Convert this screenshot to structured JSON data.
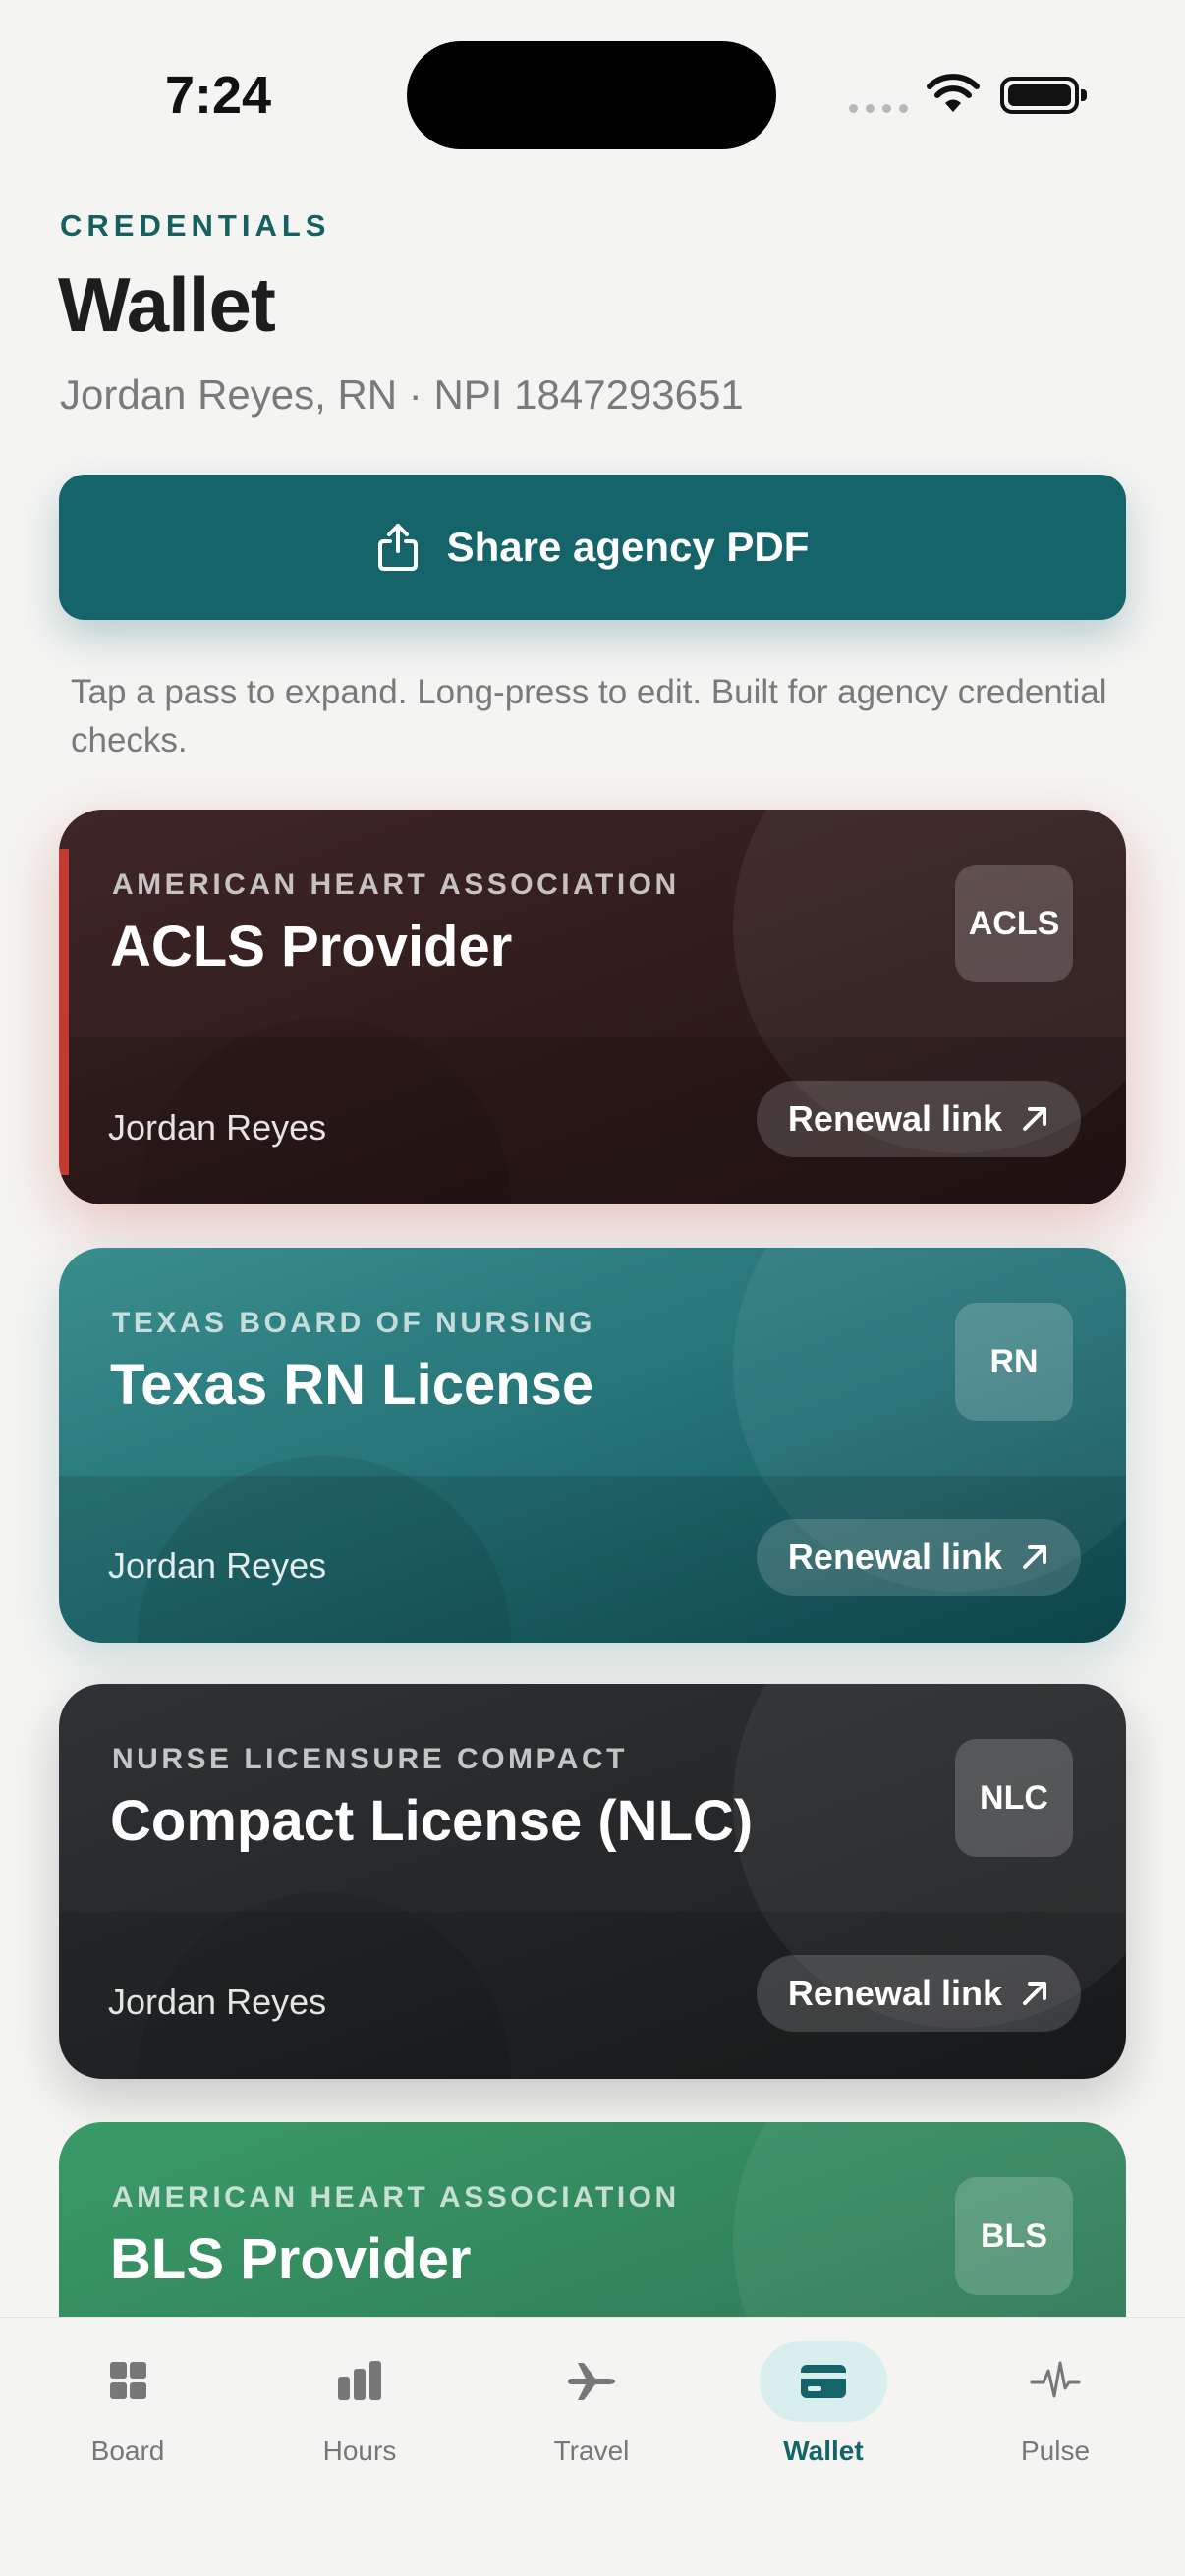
{
  "status_bar": {
    "time": "7:24"
  },
  "header": {
    "eyebrow": "CREDENTIALS",
    "title": "Wallet",
    "subtitle": "Jordan Reyes, RN · NPI 1847293651"
  },
  "share_button": {
    "label": "Share agency PDF"
  },
  "hint": "Tap a pass to expand. Long-press to edit. Built for agency credential checks.",
  "cards": [
    {
      "issuer": "AMERICAN HEART ASSOCIATION",
      "name": "ACLS Provider",
      "badge": "ACLS",
      "holder": "Jordan Reyes",
      "action": "Renewal link",
      "color": "#2d1a1a",
      "alert_color": "#c23a32"
    },
    {
      "issuer": "TEXAS BOARD OF NURSING",
      "name": "Texas RN License",
      "badge": "RN",
      "holder": "Jordan Reyes",
      "action": "Renewal link",
      "color": "#216f74"
    },
    {
      "issuer": "NURSE LICENSURE COMPACT",
      "name": "Compact License (NLC)",
      "badge": "NLC",
      "holder": "Jordan Reyes",
      "action": "Renewal link",
      "color": "#232527"
    },
    {
      "issuer": "AMERICAN HEART ASSOCIATION",
      "name": "BLS Provider",
      "badge": "BLS",
      "color": "#2f7e58"
    }
  ],
  "tabs": [
    {
      "label": "Board",
      "icon": "grid-icon"
    },
    {
      "label": "Hours",
      "icon": "bar-chart-icon"
    },
    {
      "label": "Travel",
      "icon": "airplane-icon"
    },
    {
      "label": "Wallet",
      "icon": "card-icon",
      "active": true
    },
    {
      "label": "Pulse",
      "icon": "pulse-icon"
    }
  ],
  "accent_color": "#15646a"
}
